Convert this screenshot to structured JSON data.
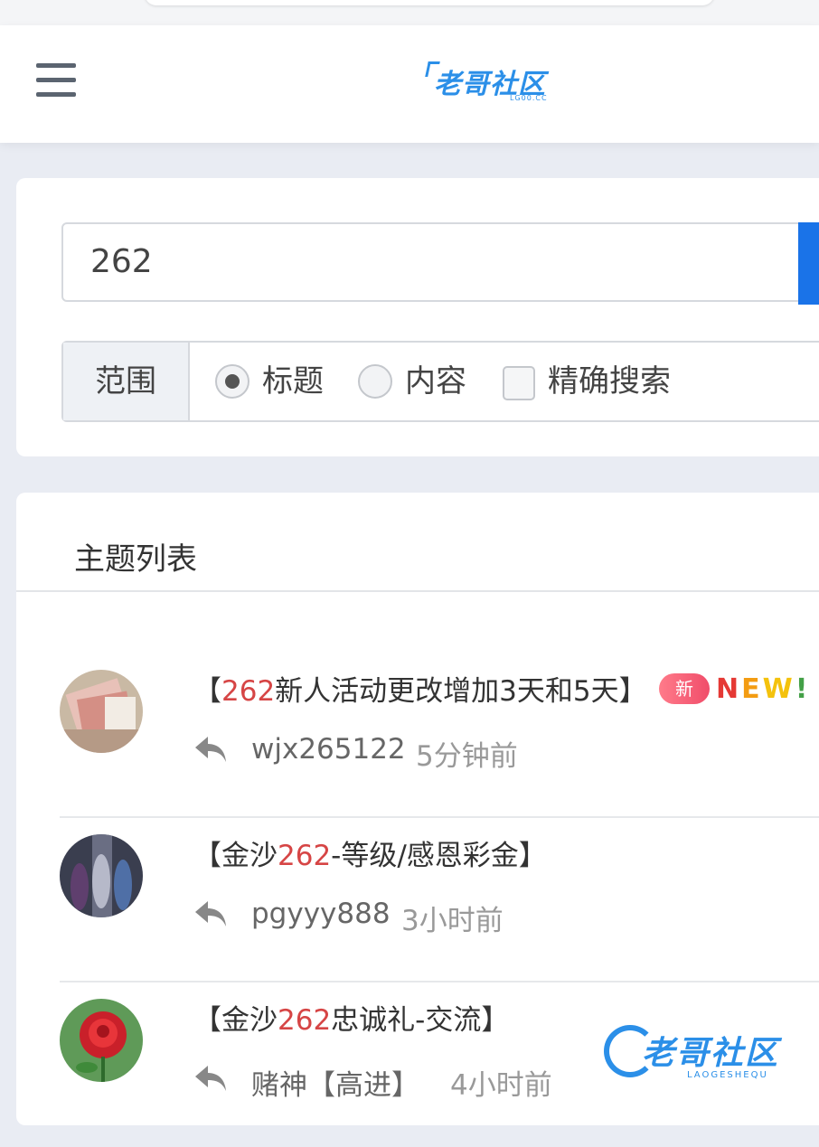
{
  "header": {
    "logo_text": "老哥社区",
    "logo_sub": "LG00.CC"
  },
  "search": {
    "query": "262"
  },
  "scope": {
    "label": "范围",
    "options": [
      {
        "label": "标题",
        "checked": true
      },
      {
        "label": "内容",
        "checked": false
      }
    ],
    "exact": {
      "label": "精确搜索",
      "checked": false
    }
  },
  "list": {
    "title": "主题列表",
    "topics": [
      {
        "prefix": "【",
        "highlight": "262",
        "suffix": "新人活动更改增加3天和5天】",
        "author": "wjx265122",
        "time": "5分钟前",
        "badge": "新",
        "new_art": "NEW!"
      },
      {
        "prefix": "【金沙",
        "highlight": "262",
        "suffix": "-等级/感恩彩金】",
        "author": "pgyyy888",
        "time": "3小时前"
      },
      {
        "prefix": "【金沙",
        "highlight": "262",
        "suffix": "忠诚礼-交流】",
        "author": "赌神【高进】",
        "time": "4小时前"
      }
    ]
  },
  "watermark": {
    "text": "老哥社区",
    "sub": "LAOGESHEQU"
  },
  "colors": {
    "accent": "#1a73e8",
    "highlight": "#d64545",
    "logo": "#2b8fe8"
  },
  "icons": [
    "menu-icon",
    "reply-icon"
  ]
}
